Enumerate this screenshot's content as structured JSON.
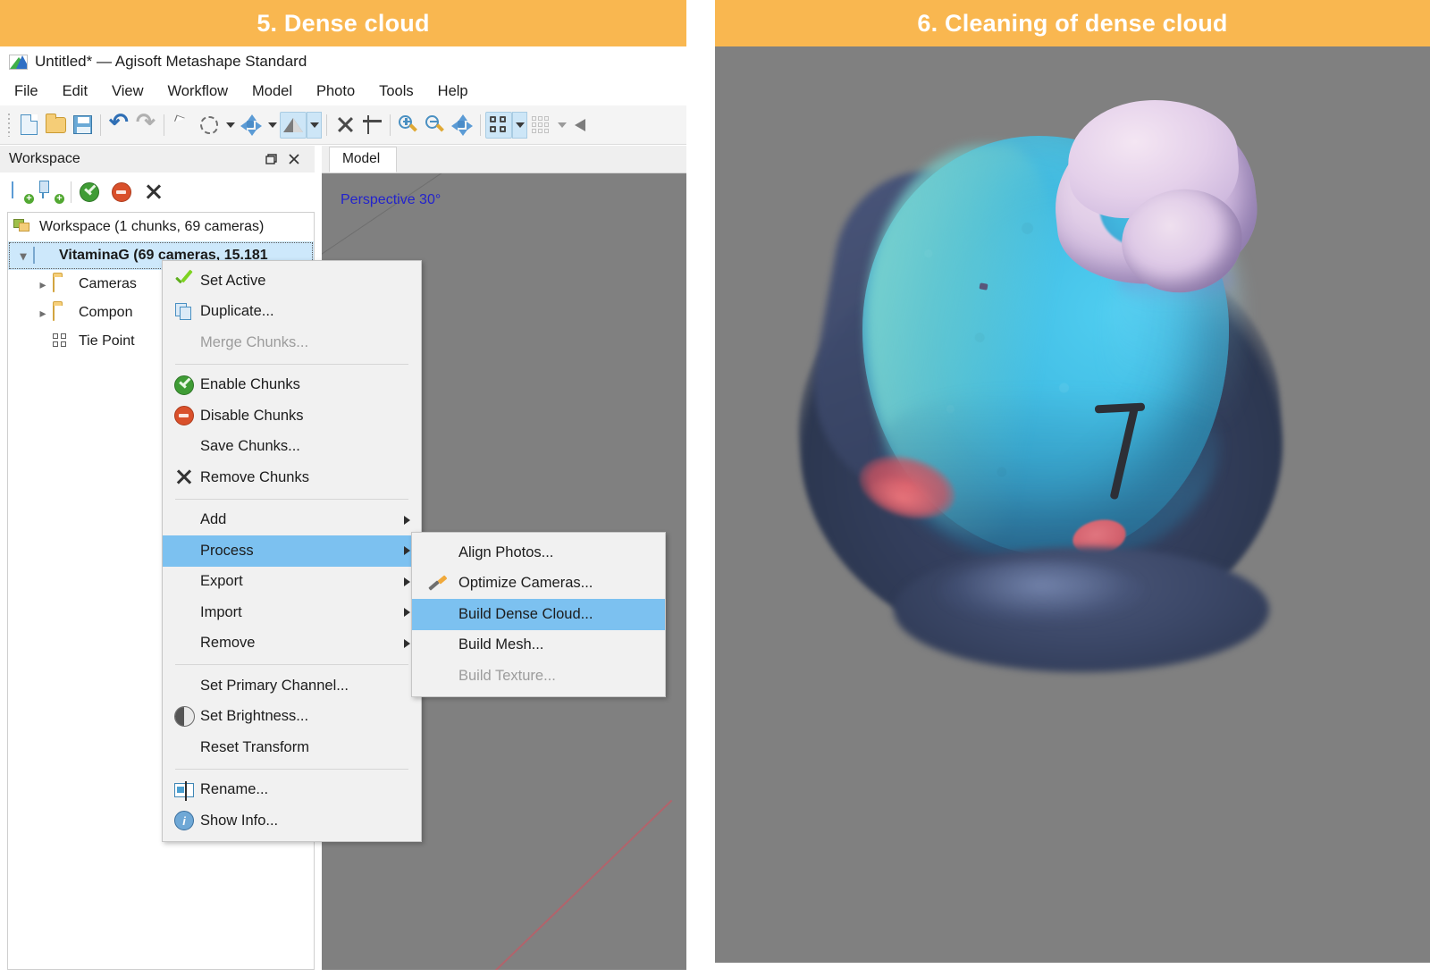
{
  "left": {
    "banner_title": "5. Dense cloud",
    "app": {
      "title": "Untitled* — Agisoft Metashape Standard",
      "logo_icon": "metashape-logo-icon"
    },
    "menubar": [
      "File",
      "Edit",
      "View",
      "Workflow",
      "Model",
      "Photo",
      "Tools",
      "Help"
    ],
    "toolbar": [
      {
        "name": "new-document-icon",
        "active": false
      },
      {
        "name": "open-folder-icon",
        "active": false
      },
      {
        "name": "save-icon",
        "active": false
      },
      {
        "name": "undo-icon",
        "active": false
      },
      {
        "name": "redo-icon",
        "active": false
      },
      {
        "name": "pointer-select-icon",
        "active": false
      },
      {
        "name": "free-form-selection-icon",
        "active": false
      },
      {
        "name": "navigation-move-icon",
        "active": false
      },
      {
        "name": "shading-mode-icon",
        "active": true
      },
      {
        "name": "delete-selection-icon",
        "active": false
      },
      {
        "name": "crop-selection-icon",
        "active": false
      },
      {
        "name": "zoom-in-icon",
        "active": false
      },
      {
        "name": "zoom-out-icon",
        "active": false
      },
      {
        "name": "reset-view-icon",
        "active": false
      },
      {
        "name": "show-cameras-icon",
        "active": true
      },
      {
        "name": "show-tie-points-icon",
        "active": false
      },
      {
        "name": "show-region-icon",
        "active": false
      }
    ],
    "workspace": {
      "title": "Workspace",
      "undock_icon": "undock-icon",
      "close_icon": "close-icon",
      "tools": [
        {
          "name": "add-chunk-icon"
        },
        {
          "name": "add-photos-icon"
        },
        {
          "name": "enable-icon"
        },
        {
          "name": "disable-icon"
        },
        {
          "name": "remove-icon"
        }
      ],
      "tree": [
        {
          "label": "Workspace (1 chunks, 69 cameras)",
          "icon": "workspace-icon",
          "indent": 0,
          "expander": "",
          "selected": false,
          "bold": false
        },
        {
          "label": "VitaminaG (69 cameras, 15.181",
          "icon": "chunk-icon",
          "indent": 1,
          "expander": "v",
          "selected": true,
          "bold": true
        },
        {
          "label": "Cameras",
          "icon": "folder-icon",
          "indent": 2,
          "expander": ">",
          "selected": false,
          "bold": false
        },
        {
          "label": "Compon",
          "icon": "folder-icon",
          "indent": 2,
          "expander": ">",
          "selected": false,
          "bold": false
        },
        {
          "label": "Tie Point",
          "icon": "tie-points-icon",
          "indent": 2,
          "expander": "",
          "selected": false,
          "bold": false
        }
      ]
    },
    "model_pane": {
      "tab_label": "Model",
      "viewport_label": "Perspective 30°"
    },
    "context_menu": [
      {
        "label": "Set Active",
        "icon": "green-check-icon",
        "disabled": false,
        "submenu": false,
        "highlight": false
      },
      {
        "label": "Duplicate...",
        "icon": "duplicate-icon",
        "disabled": false,
        "submenu": false,
        "highlight": false
      },
      {
        "label": "Merge Chunks...",
        "icon": "",
        "disabled": true,
        "submenu": false,
        "highlight": false
      },
      {
        "separator": true
      },
      {
        "label": "Enable Chunks",
        "icon": "enable-icon",
        "disabled": false,
        "submenu": false,
        "highlight": false
      },
      {
        "label": "Disable Chunks",
        "icon": "disable-icon",
        "disabled": false,
        "submenu": false,
        "highlight": false
      },
      {
        "label": "Save Chunks...",
        "icon": "",
        "disabled": false,
        "submenu": false,
        "highlight": false
      },
      {
        "label": "Remove Chunks",
        "icon": "x-icon",
        "disabled": false,
        "submenu": false,
        "highlight": false
      },
      {
        "separator": true
      },
      {
        "label": "Add",
        "icon": "",
        "disabled": false,
        "submenu": true,
        "highlight": false
      },
      {
        "label": "Process",
        "icon": "",
        "disabled": false,
        "submenu": true,
        "highlight": true
      },
      {
        "label": "Export",
        "icon": "",
        "disabled": false,
        "submenu": true,
        "highlight": false
      },
      {
        "label": "Import",
        "icon": "",
        "disabled": false,
        "submenu": true,
        "highlight": false
      },
      {
        "label": "Remove",
        "icon": "",
        "disabled": false,
        "submenu": true,
        "highlight": false
      },
      {
        "separator": true
      },
      {
        "label": "Set Primary Channel...",
        "icon": "",
        "disabled": false,
        "submenu": false,
        "highlight": false
      },
      {
        "label": "Set Brightness...",
        "icon": "brightness-icon",
        "disabled": false,
        "submenu": false,
        "highlight": false
      },
      {
        "label": "Reset Transform",
        "icon": "",
        "disabled": false,
        "submenu": false,
        "highlight": false
      },
      {
        "separator": true
      },
      {
        "label": "Rename...",
        "icon": "rename-icon",
        "disabled": false,
        "submenu": false,
        "highlight": false
      },
      {
        "label": "Show Info...",
        "icon": "info-icon",
        "disabled": false,
        "submenu": false,
        "highlight": false
      }
    ],
    "context_submenu": [
      {
        "label": "Align Photos...",
        "icon": "",
        "disabled": false,
        "highlight": false
      },
      {
        "label": "Optimize Cameras...",
        "icon": "wand-icon",
        "disabled": false,
        "highlight": false
      },
      {
        "label": "Build Dense Cloud...",
        "icon": "",
        "disabled": false,
        "highlight": true
      },
      {
        "label": "Build Mesh...",
        "icon": "",
        "disabled": false,
        "highlight": false
      },
      {
        "label": "Build Texture...",
        "icon": "",
        "disabled": true,
        "highlight": false
      }
    ]
  },
  "right": {
    "banner_title": "6. Cleaning of dense cloud",
    "model": {
      "description_icon": "dense-cloud-model-render",
      "background_color": "#808080"
    }
  },
  "colors": {
    "banner": "#f9b750",
    "banner_text": "#ffffff",
    "menu_highlight": "#7cc1f0",
    "tree_selection": "#cde8fb",
    "viewport_bg": "#808080",
    "viewport_label": "#2323cc",
    "toolbar_active": "#cde6f7"
  }
}
